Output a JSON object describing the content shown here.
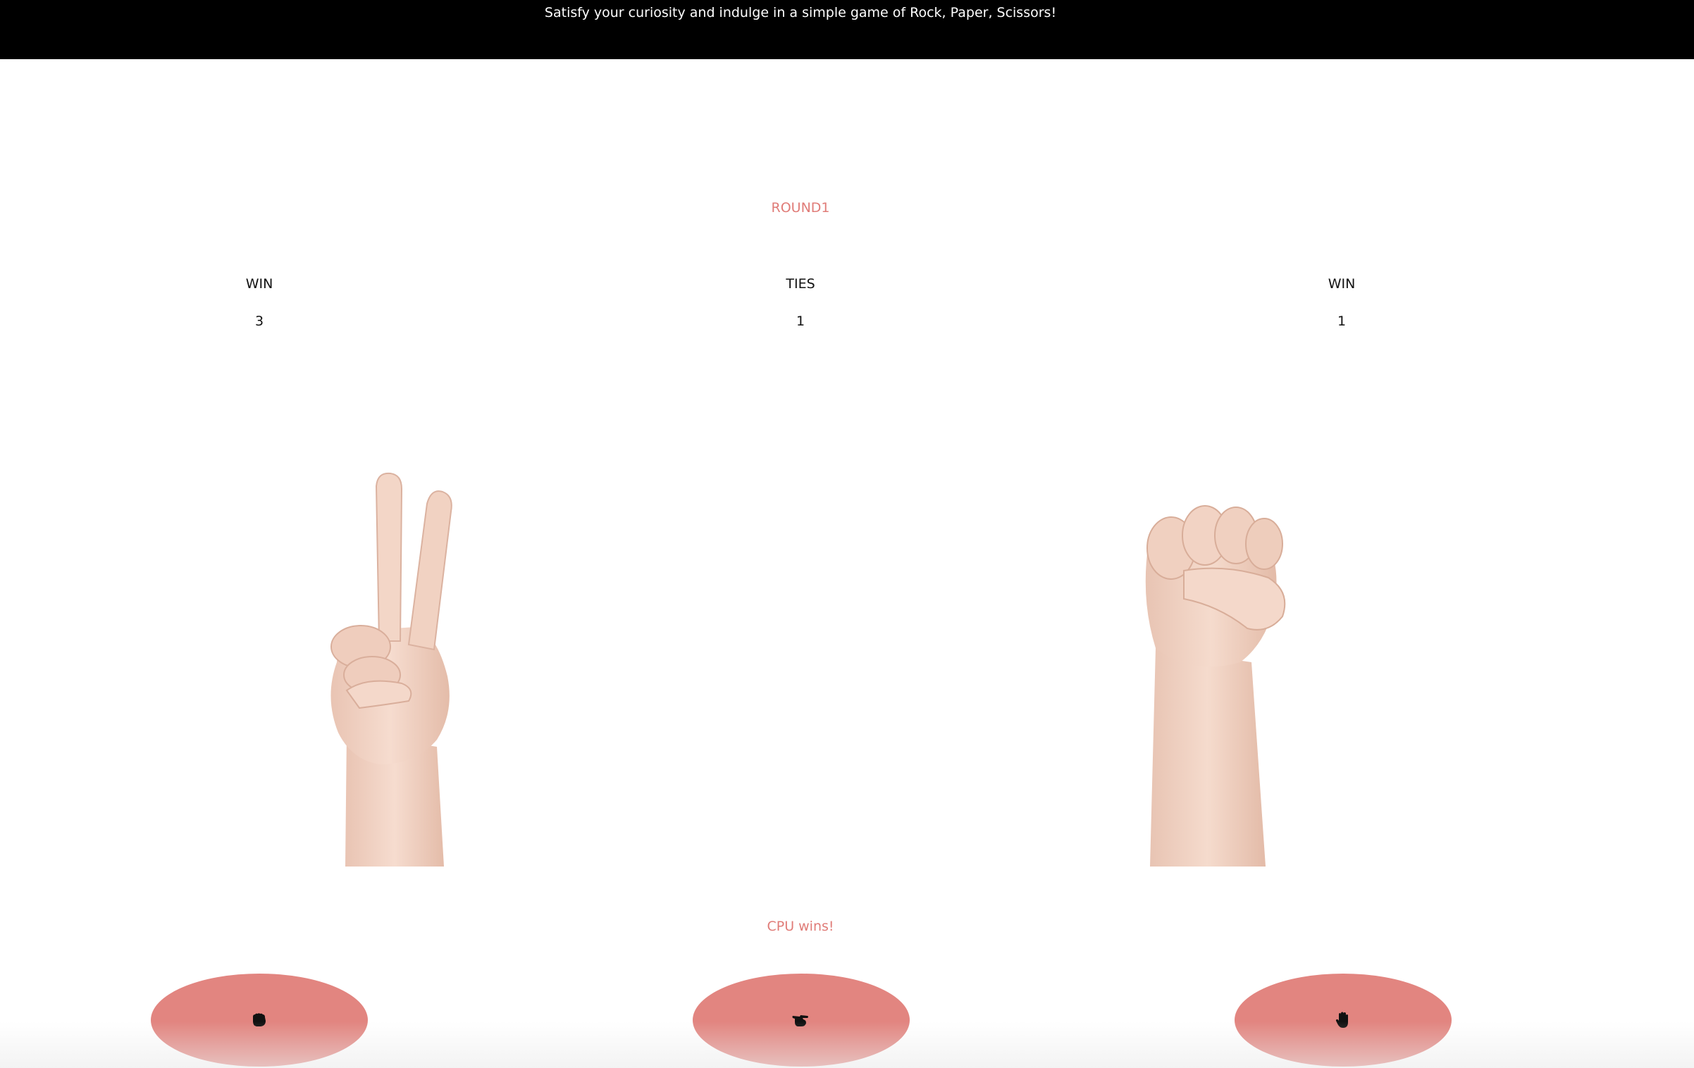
{
  "header": {
    "tagline": "Satisfy your curiosity and indulge in a simple game of Rock, Paper, Scissors!"
  },
  "game": {
    "round_label": "ROUND1",
    "scores": {
      "player": {
        "label": "WIN",
        "value": "3"
      },
      "ties": {
        "label": "TIES",
        "value": "1"
      },
      "cpu": {
        "label": "WIN",
        "value": "1"
      }
    },
    "player_hand": "scissors",
    "cpu_hand": "rock",
    "result": "CPU wins!"
  },
  "controls": {
    "buttons": [
      {
        "choice": "rock",
        "icon": "fist-icon"
      },
      {
        "choice": "scissors",
        "icon": "scissors-hand-icon"
      },
      {
        "choice": "paper",
        "icon": "open-hand-icon"
      }
    ]
  },
  "colors": {
    "accent": "#e07c78",
    "button": "#e28580",
    "topbar": "#000000",
    "skin": "#f1cfbf"
  }
}
